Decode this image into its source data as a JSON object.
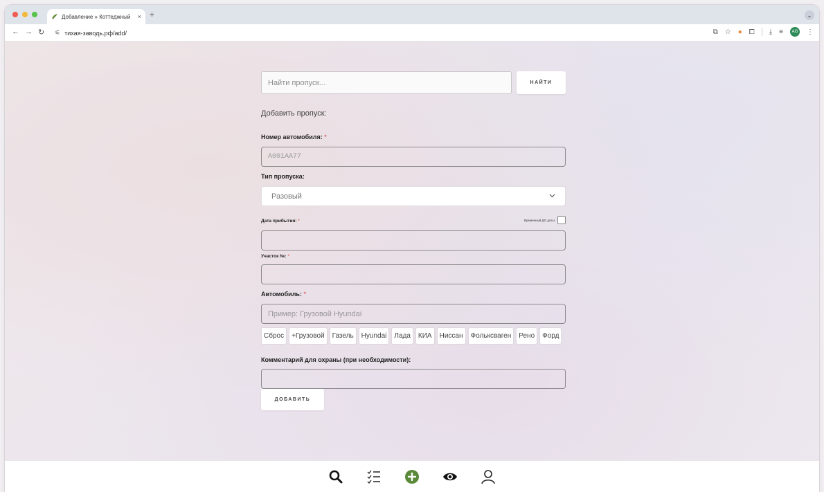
{
  "browser": {
    "tab_title": "Добавление » Коттеджный",
    "tab_close": "×",
    "new_tab": "+",
    "url": "тихая-заводь.рф/add/",
    "profile_initials": "AG"
  },
  "search": {
    "placeholder": "Найти пропуск...",
    "button_label": "НАЙТИ"
  },
  "form": {
    "title": "Добавить пропуск:",
    "car_number": {
      "label": "Номер автомобиля:",
      "required_mark": "*",
      "placeholder": "А001АА77"
    },
    "pass_type": {
      "label": "Тип пропуска:",
      "selected": "Разовый"
    },
    "arrival_date": {
      "label": "Дата прибытия:",
      "required_mark": "*",
      "value": ""
    },
    "temporary_until": {
      "label": "Временный ДО даты:",
      "checked": false
    },
    "plot_number": {
      "label": "Участок №:",
      "required_mark": "*",
      "value": ""
    },
    "car": {
      "label": "Автомобиль:",
      "required_mark": "*",
      "placeholder": "Пример: Грузовой Hyundai",
      "chips": [
        "Сброс",
        "+Грузовой",
        "Газель",
        "Hyundai",
        "Лада",
        "КИА",
        "Ниссан",
        "Фольксваген",
        "Рено",
        "Форд"
      ]
    },
    "comment": {
      "label": "Комментарий для охраны (при необходимости):",
      "value": ""
    },
    "submit_label": "ДОБАВИТЬ"
  },
  "bottom_nav": [
    {
      "name": "search-icon"
    },
    {
      "name": "checklist-icon"
    },
    {
      "name": "add-circle-icon",
      "color": "#5a8a3a"
    },
    {
      "name": "eye-icon"
    },
    {
      "name": "user-icon"
    }
  ]
}
